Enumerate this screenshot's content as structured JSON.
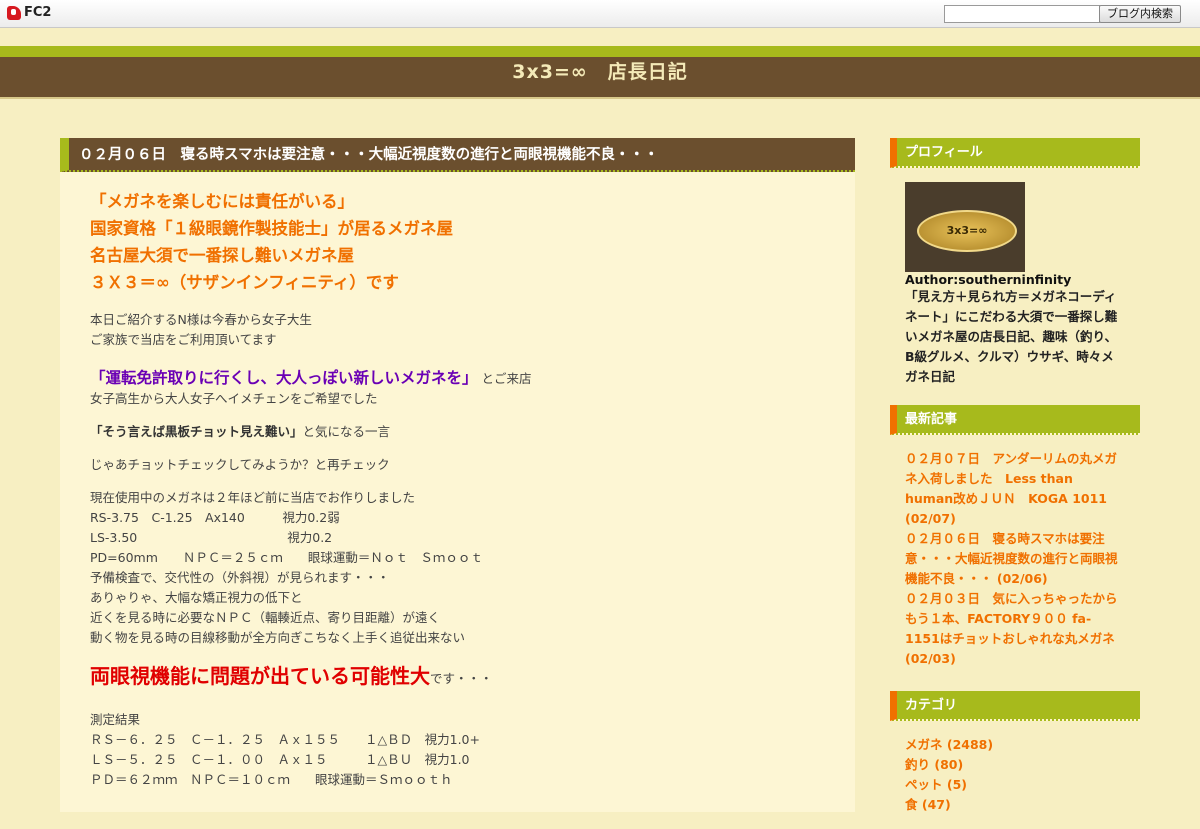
{
  "fc2": {
    "logo": "FC2",
    "search_value": "",
    "search_button": "ブログ内検索"
  },
  "blog": {
    "title": "3x3=∞　店長日記"
  },
  "post": {
    "title": "０２月０６日　寝る時スマホは要注意・・・大幅近視度数の進行と両眼視機能不良・・・",
    "lead": [
      "「メガネを楽しむには責任がいる」",
      "国家資格「１級眼鏡作製技能士」が居るメガネ屋",
      "名古屋大須で一番探し難いメガネ屋",
      "３Ｘ３＝∞（サザンインフィニティ）です"
    ],
    "intro": [
      "本日ご紹介するN様は今春から女子大生",
      "ご家族で当店をご利用頂いてます"
    ],
    "purple_quote": "「運転免許取りに行くし、大人っぽい新しいメガネを」",
    "purple_suffix": "とご来店",
    "line_image_change": "女子高生から大人女子へイメチェンをご希望でした",
    "blackboard_quote": "「そう言えば黒板チョット見え難い」",
    "blackboard_suffix": "と気になる一言",
    "check_line": "じゃあチョットチェックしてみようか？と再チェック",
    "current_glasses": [
      "現在使用中のメガネは２年ほど前に当店でお作りしました",
      "RS-3.75　C-1.25　Ax140　　　視力0.2弱",
      "LS-3.50　　　　　　　　　　　　視力0.2",
      "PD=60mm　　ＮＰＣ＝２５ｃｍ　　眼球運動＝Ｎｏｔ　Ｓｍｏｏｔ",
      "予備検査で、交代性の（外斜視）が見られます・・・",
      "ありゃりゃ、大幅な矯正視力の低下と",
      "近くを見る時に必要なＮＰＣ（輻輳近点、寄り目距離）が遠く",
      "動く物を見る時の目線移動が全方向ぎこちなく上手く追従出来ない"
    ],
    "big_red": "両眼視機能に問題が出ている可能性大",
    "big_red_suffix": "です・・・",
    "results_label": "測定結果",
    "results": [
      "ＲＳ－６．２５　Ｃ－１．２５　Ａｘ１５５　　１△ＢＤ　視力1.0+",
      "ＬＳ－５．２５　Ｃ－１．００　Ａｘ１５　　　１△ＢＵ　視力1.0",
      "ＰＤ＝６２ｍｍ　ＮＰＣ＝１０ｃｍ　　眼球運動＝Ｓｍｏｏｔｈ"
    ]
  },
  "sidebar": {
    "profile": {
      "heading": "プロフィール",
      "avatar_text": "3x3=∞",
      "author": "Author:southerninfinity",
      "description": "「見え方＋見られ方＝メガネコーディネート」にこだわる大須で一番探し難いメガネ屋の店長日記、趣味（釣り、B級グルメ、クルマ）ウサギ、時々メガネ日記"
    },
    "recent": {
      "heading": "最新記事",
      "items": [
        "０２月０７日　アンダーリムの丸メガネ入荷しました　Less than human改めＪＵＮ　KOGA 1011 (02/07)",
        "０２月０６日　寝る時スマホは要注意・・・大幅近視度数の進行と両眼視機能不良・・・ (02/06)",
        "０２月０３日　気に入っちゃったからもう１本、FACTORY９００ fa-1151はチョットおしゃれな丸メガネ (02/03)"
      ]
    },
    "categories": {
      "heading": "カテゴリ",
      "items": [
        "メガネ (2488)",
        "釣り (80)",
        "ペット (5)",
        "食 (47)"
      ]
    }
  },
  "colors": {
    "header_brown": "#6b4f2e",
    "accent_green": "#a7ba1c",
    "accent_orange": "#f07000",
    "page_bg": "#f7efc2"
  }
}
